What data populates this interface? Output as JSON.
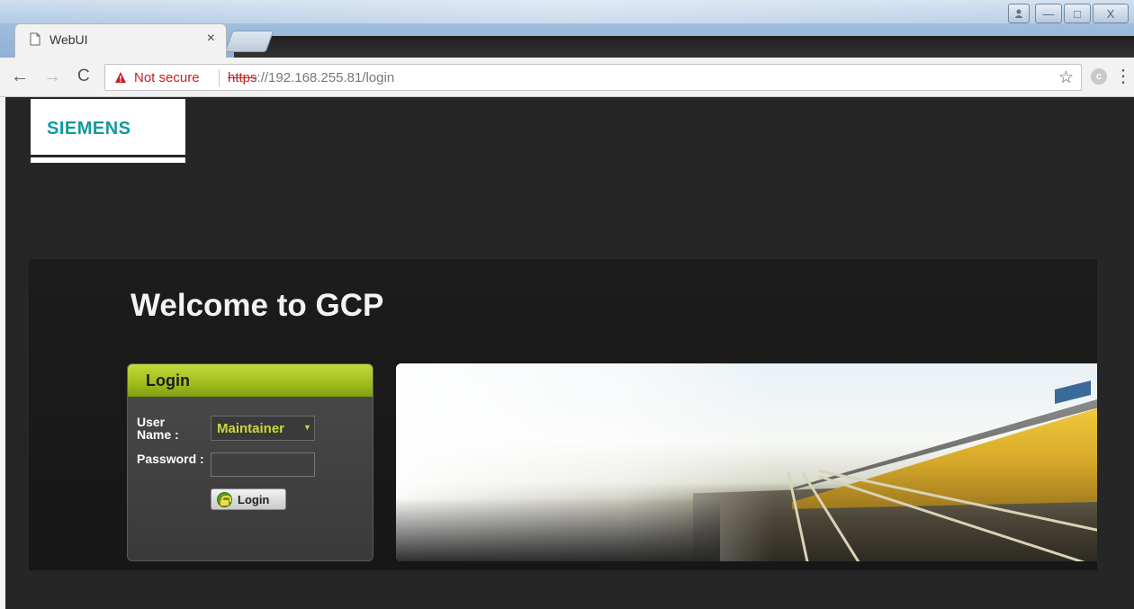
{
  "browser": {
    "tab_title": "WebUI",
    "tab_close": "×",
    "security_label": "Not secure",
    "url_scheme": "https",
    "url_rest": "://192.168.255.81/login",
    "colors": {
      "insecure": "#c5221f"
    },
    "icons": [
      "page-icon",
      "back-icon",
      "forward-icon",
      "reload-icon",
      "warning-icon",
      "star-icon",
      "extension-icon",
      "menu-icon"
    ]
  },
  "window": {
    "minimize": "—",
    "maximize": "□",
    "close": "X"
  },
  "page": {
    "logo_text": "SIEMENS",
    "welcome": "Welcome to GCP",
    "login": {
      "header": "Login",
      "username_label": "User Name :",
      "username_value": "Maintainer",
      "password_label": "Password :",
      "button_label": "Login"
    },
    "colors": {
      "logo": "#139a9b",
      "login_header": "#9fbd1d",
      "select_text": "#c8d83a"
    }
  }
}
